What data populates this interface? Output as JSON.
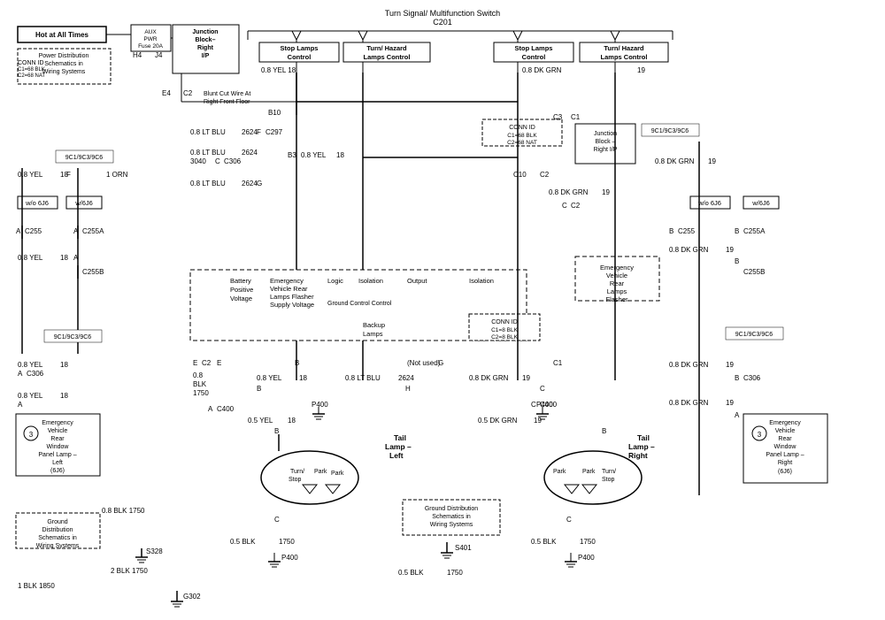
{
  "title": "Turn Signal/ Multifunction Switch C201",
  "diagram": {
    "top_title": "Turn Signal/ Multifunction Switch",
    "top_title2": "C201",
    "sections": {
      "stop_lamps_control_left": "Stop Lamps Control",
      "turn_hazard_left": "Turn/ Hazard Lamps Control",
      "stop_lamps_control_right": "Stop Lamps Control",
      "turn_hazard_right": "Turn/ Hazard Lamps Control"
    },
    "wires": {
      "yel_18": "0.8 YEL 18",
      "dk_grn_19": "0.8 DK GRN 19",
      "lt_blu_2624": "0.8 LT BLU 2624",
      "lt_blu_3040": "0.8 LT BLU 3040",
      "blk_1750": "0.8 BLK 1750",
      "blk_2blk": "2 BLK 1750",
      "blk_1blk": "1 BLK 1850"
    },
    "connectors": {
      "c255": "C255",
      "c255a": "C255A",
      "c255b": "C255B",
      "c297": "C297",
      "c306": "C306",
      "c400": "C400",
      "p400": "P400",
      "s328": "S328",
      "s401": "S401",
      "g302": "G302"
    },
    "components": {
      "junction_block": "Junction Block- Right I/P",
      "hot_at_all_times": "Hot at All Times",
      "aux_pwr_fuse_20a": "AUX PWR Fuse 20A",
      "emergency_flasher": "Emergency Vehicle Rear Lamps Flasher",
      "tail_lamp_left": "Tail Lamp – Left",
      "tail_lamp_right": "Tail Lamp – Right",
      "ev_rear_window_left": "Emergency Vehicle Rear Window Panel Lamp – Left (6J6)",
      "ev_rear_window_right": "Emergency Vehicle Rear Window Panel Lamp – Right (6J6)",
      "ground_dist": "Ground Distribution Schematics in Wiring Systems",
      "power_dist": "Power Distribution Schematics in Wiring Systems",
      "backup_lamps": "Backup Lamps",
      "not_used": "(Not used)"
    }
  }
}
